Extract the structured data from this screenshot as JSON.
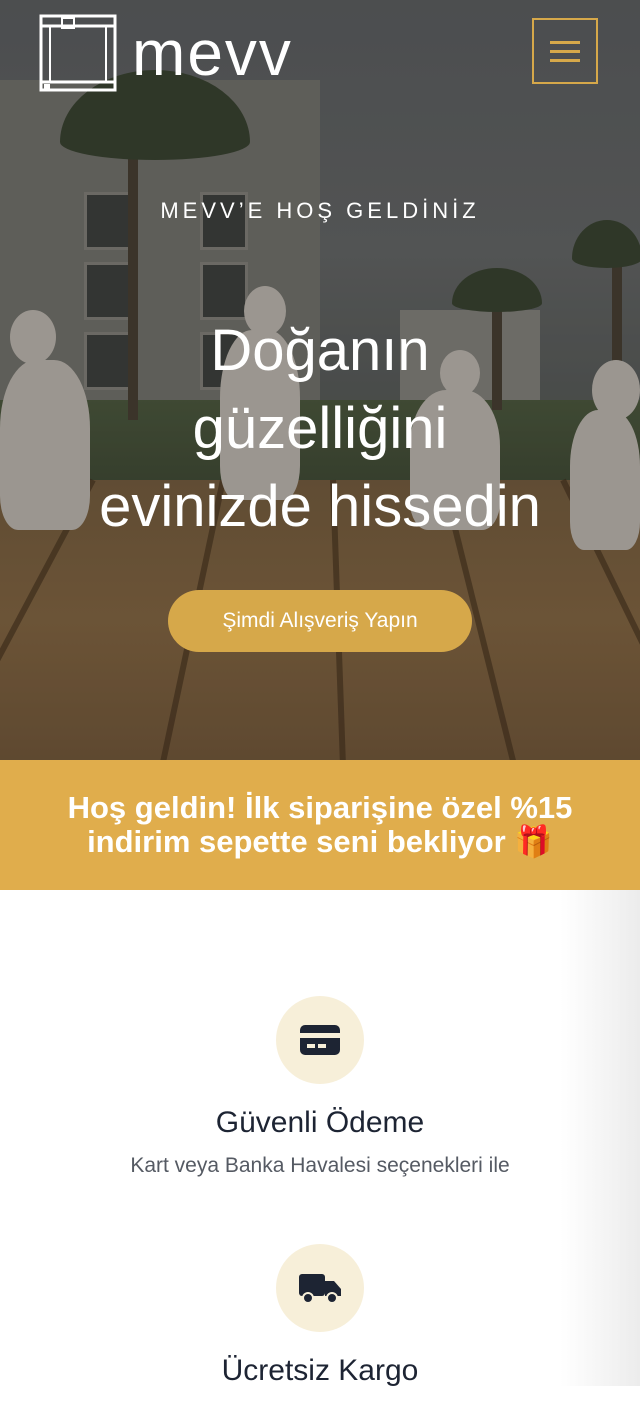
{
  "header": {
    "brand_name": "mevv",
    "logo_icon": "printer-frame-logo",
    "menu_icon": "hamburger-menu-icon"
  },
  "hero": {
    "eyebrow": "MEVV’E HOŞ GELDİNİZ",
    "headline_line1": "Doğanın",
    "headline_line2": "güzelliğini",
    "headline_line3": "evinizde hissedin",
    "cta_label": "Şimdi Alışveriş Yapın"
  },
  "promo": {
    "line1": "Hoş geldin! İlk siparişine özel %15",
    "line2": "indirim sepette seni bekliyor 🎁"
  },
  "features": [
    {
      "icon": "credit-card-icon",
      "title": "Güvenli Ödeme",
      "description": "Kart veya Banka Havalesi seçenekleri ile"
    },
    {
      "icon": "truck-icon",
      "title": "Ücretsiz Kargo",
      "description": ""
    }
  ],
  "colors": {
    "accent": "#d6a84a",
    "promo_bg": "#e0ad4c",
    "icon_circle_bg": "#f7efd9",
    "title_text": "#1d2433"
  }
}
